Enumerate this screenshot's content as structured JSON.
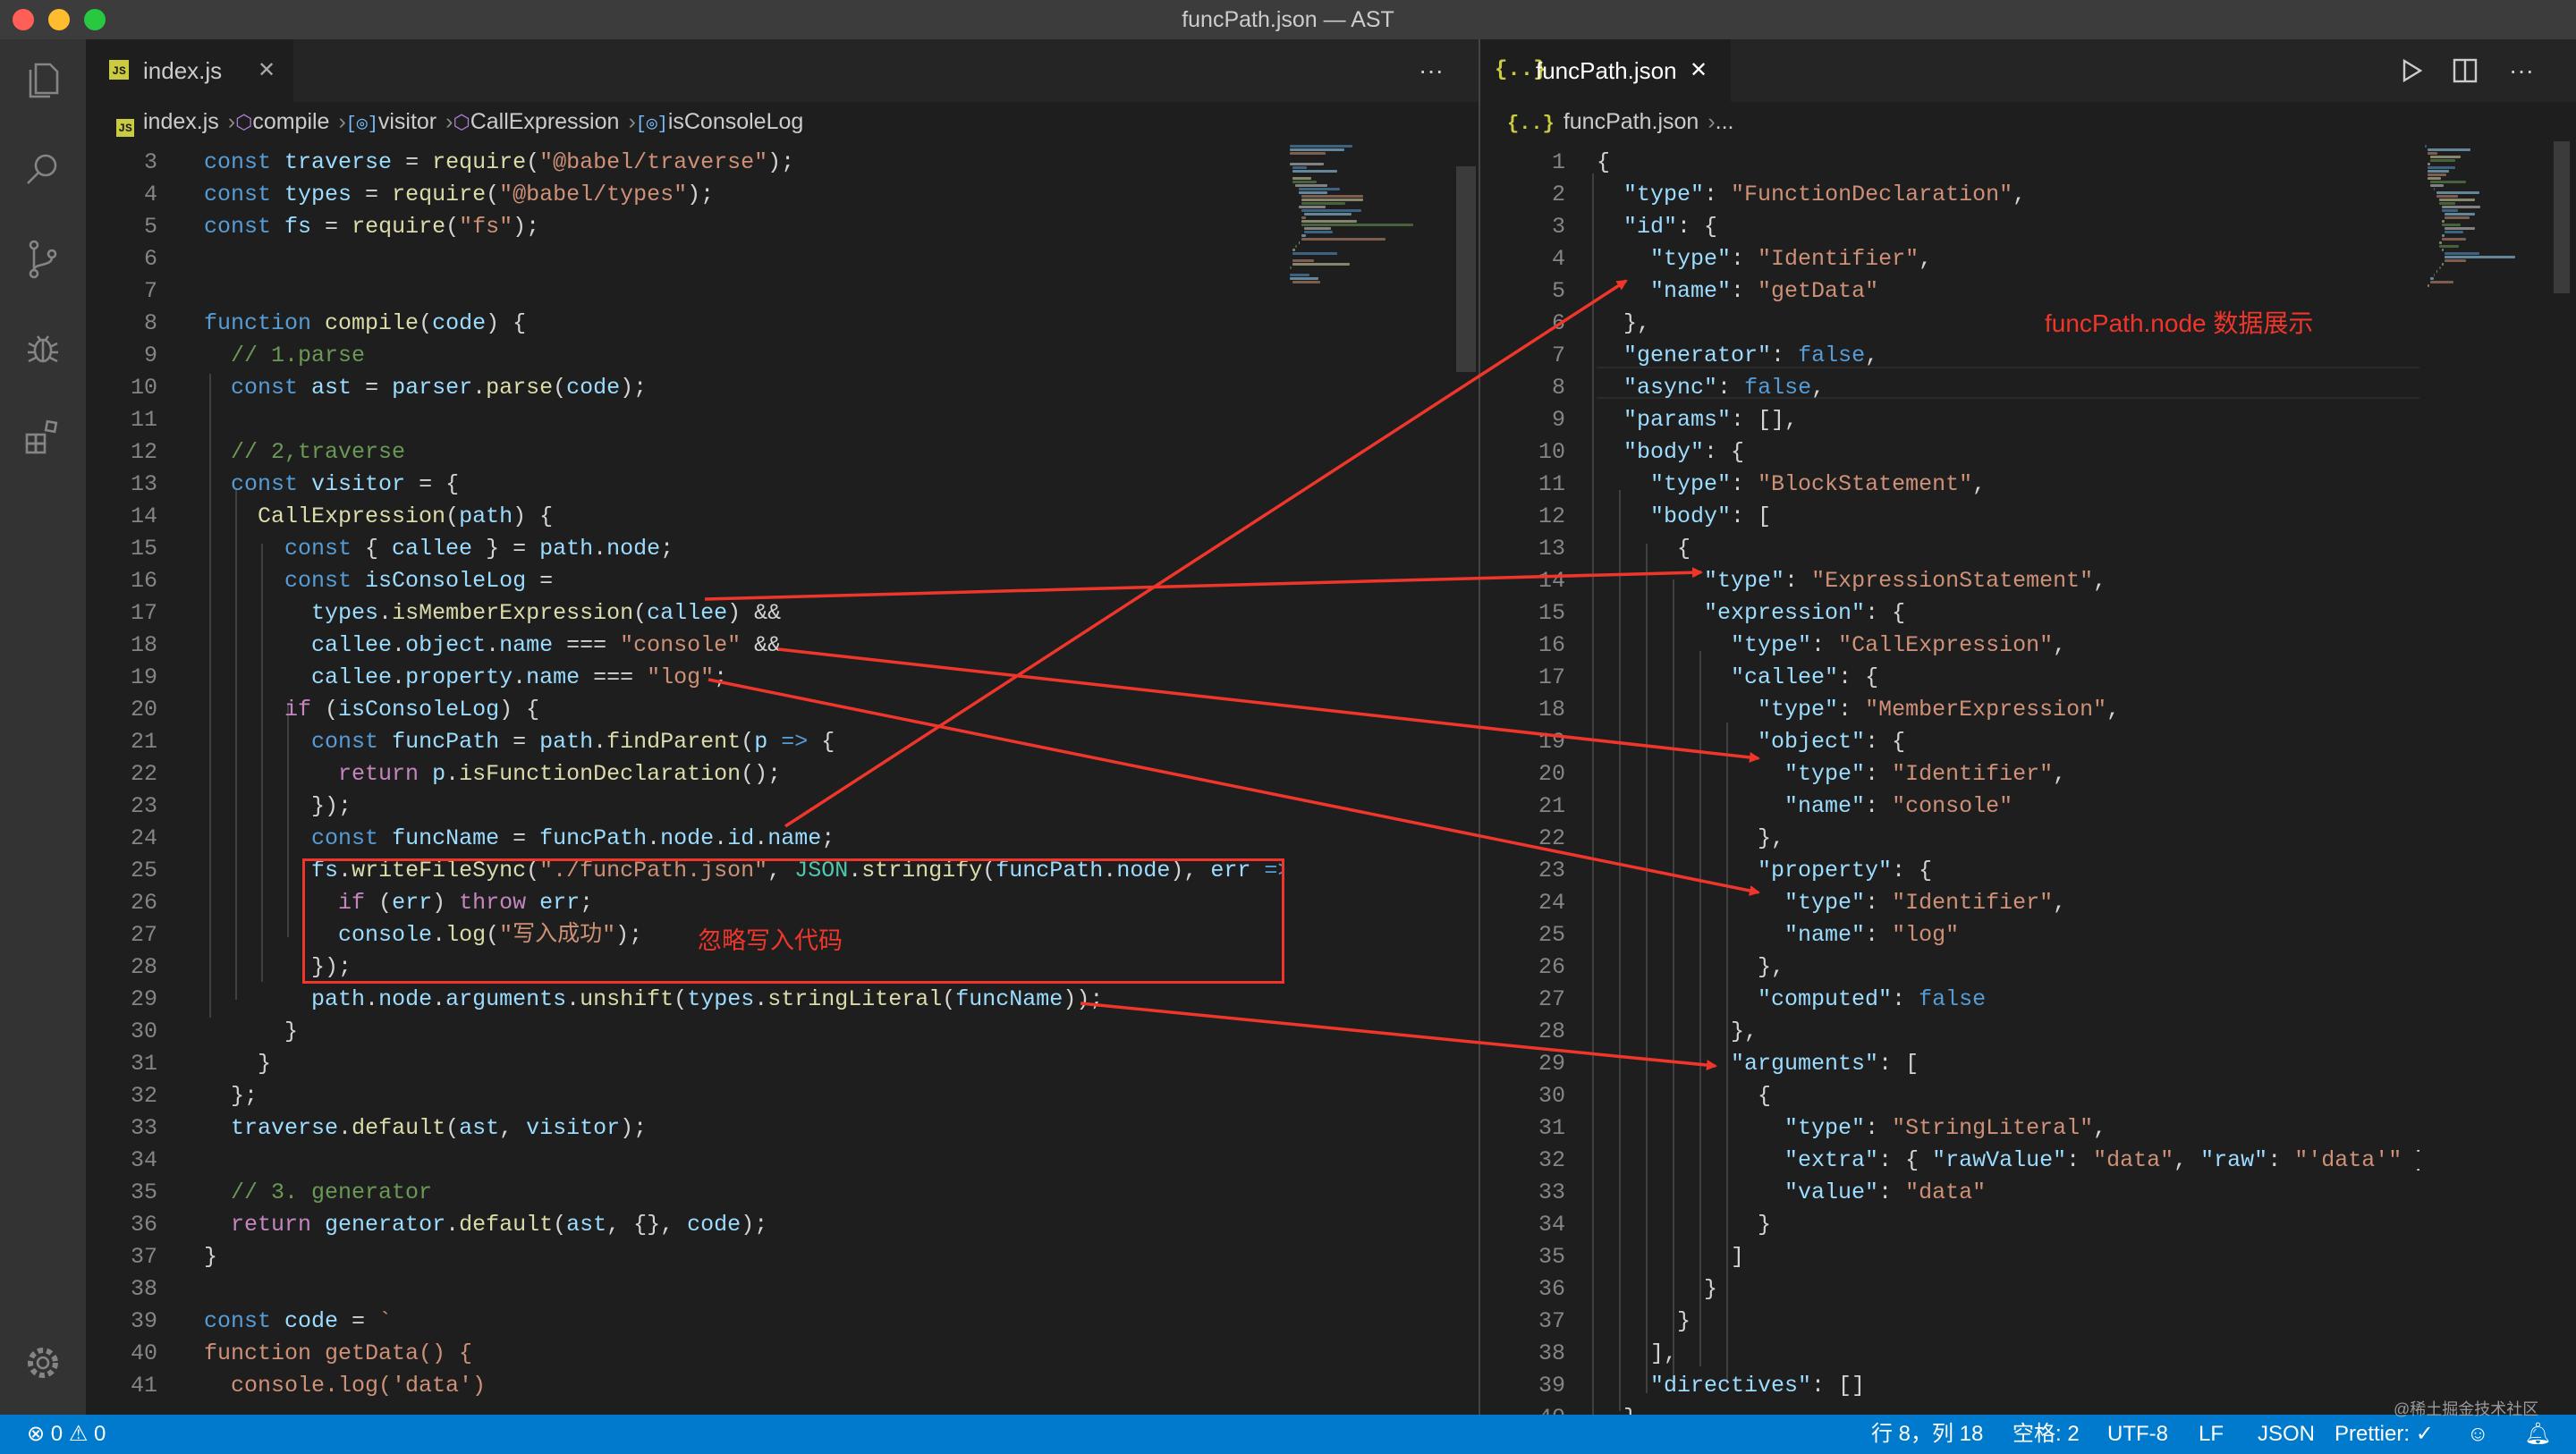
{
  "window": {
    "title": "funcPath.json — AST"
  },
  "colors": {
    "accent": "#007acc",
    "annotation": "#f0362b",
    "editor_bg": "#1e1e1e"
  },
  "activity_bar": {
    "items": [
      {
        "name": "explorer",
        "icon": "files-icon"
      },
      {
        "name": "search",
        "icon": "search-icon"
      },
      {
        "name": "source-control",
        "icon": "source-control-icon"
      },
      {
        "name": "run-debug",
        "icon": "debug-icon"
      },
      {
        "name": "extensions",
        "icon": "extensions-icon"
      }
    ],
    "settings_icon": "gear-icon"
  },
  "left_editor": {
    "tab": {
      "label": "index.js",
      "icon_text": "JS"
    },
    "more_label": "···",
    "breadcrumbs": [
      "index.js",
      "compile",
      "visitor",
      "CallExpression",
      "isConsoleLog"
    ],
    "lines": [
      {
        "n": "3",
        "html": "<span class=\"k\">const</span> <span class=\"v\">traverse</span> = <span class=\"f\">require</span>(<span class=\"s\">\"@babel/traverse\"</span>);"
      },
      {
        "n": "4",
        "html": "<span class=\"k\">const</span> <span class=\"v\">types</span> = <span class=\"f\">require</span>(<span class=\"s\">\"@babel/types\"</span>);"
      },
      {
        "n": "5",
        "html": "<span class=\"k\">const</span> <span class=\"v\">fs</span> = <span class=\"f\">require</span>(<span class=\"s\">\"fs\"</span>);"
      },
      {
        "n": "6",
        "html": ""
      },
      {
        "n": "7",
        "html": ""
      },
      {
        "n": "8",
        "html": "<span class=\"k\">function</span> <span class=\"f\">compile</span>(<span class=\"v\">code</span>) {"
      },
      {
        "n": "9",
        "html": "  <span class=\"cm\">// 1.parse</span>"
      },
      {
        "n": "10",
        "html": "  <span class=\"k\">const</span> <span class=\"v\">ast</span> = <span class=\"v\">parser</span>.<span class=\"f\">parse</span>(<span class=\"v\">code</span>);"
      },
      {
        "n": "11",
        "html": ""
      },
      {
        "n": "12",
        "html": "  <span class=\"cm\">// 2,traverse</span>"
      },
      {
        "n": "13",
        "html": "  <span class=\"k\">const</span> <span class=\"v\">visitor</span> = {"
      },
      {
        "n": "14",
        "html": "    <span class=\"f\">CallExpression</span>(<span class=\"v\">path</span>) {"
      },
      {
        "n": "15",
        "html": "      <span class=\"k\">const</span> { <span class=\"v\">callee</span> } = <span class=\"v\">path</span>.<span class=\"v\">node</span>;"
      },
      {
        "n": "16",
        "html": "      <span class=\"k\">const</span> <span class=\"v\">isConsoleLog</span> ="
      },
      {
        "n": "17",
        "html": "        <span class=\"v\">types</span>.<span class=\"f\">isMemberExpression</span>(<span class=\"v\">callee</span>) &amp;&amp;"
      },
      {
        "n": "18",
        "html": "        <span class=\"v\">callee</span>.<span class=\"v\">object</span>.<span class=\"v\">name</span> === <span class=\"s\">\"console\"</span> &amp;&amp;"
      },
      {
        "n": "19",
        "html": "        <span class=\"v\">callee</span>.<span class=\"v\">property</span>.<span class=\"v\">name</span> === <span class=\"s\">\"log\"</span>;"
      },
      {
        "n": "20",
        "html": "      <span class=\"c\">if</span> (<span class=\"v\">isConsoleLog</span>) {"
      },
      {
        "n": "21",
        "html": "        <span class=\"k\">const</span> <span class=\"v\">funcPath</span> = <span class=\"v\">path</span>.<span class=\"f\">findParent</span>(<span class=\"v\">p</span> <span class=\"k\">=&gt;</span> {"
      },
      {
        "n": "22",
        "html": "          <span class=\"c\">return</span> <span class=\"v\">p</span>.<span class=\"f\">isFunctionDeclaration</span>();"
      },
      {
        "n": "23",
        "html": "        });"
      },
      {
        "n": "24",
        "html": "        <span class=\"k\">const</span> <span class=\"v\">funcName</span> = <span class=\"v\">funcPath</span>.<span class=\"v\">node</span>.<span class=\"v\">id</span>.<span class=\"v\">name</span>;"
      },
      {
        "n": "25",
        "html": "        <span class=\"v\">fs</span>.<span class=\"f\">writeFileSync</span>(<span class=\"s\">\"./funcPath.json\"</span>, <span class=\"t\">JSON</span>.<span class=\"f\">stringify</span>(<span class=\"v\">funcPath</span>.<span class=\"v\">node</span>), <span class=\"v\">err</span> <span class=\"k\">=&gt;</span> {"
      },
      {
        "n": "26",
        "html": "          <span class=\"c\">if</span> (<span class=\"v\">err</span>) <span class=\"c\">throw</span> <span class=\"v\">err</span>;"
      },
      {
        "n": "27",
        "html": "          <span class=\"v\">console</span>.<span class=\"f\">log</span>(<span class=\"s\">\"写入成功\"</span>);"
      },
      {
        "n": "28",
        "html": "        });"
      },
      {
        "n": "29",
        "html": "        <span class=\"v\">path</span>.<span class=\"v\">node</span>.<span class=\"v\">arguments</span>.<span class=\"f\">unshift</span>(<span class=\"v\">types</span>.<span class=\"f\">stringLiteral</span>(<span class=\"v\">funcName</span>));"
      },
      {
        "n": "30",
        "html": "      }"
      },
      {
        "n": "31",
        "html": "    }"
      },
      {
        "n": "32",
        "html": "  };"
      },
      {
        "n": "33",
        "html": "  <span class=\"v\">traverse</span>.<span class=\"f\">default</span>(<span class=\"v\">ast</span>, <span class=\"v\">visitor</span>);"
      },
      {
        "n": "34",
        "html": ""
      },
      {
        "n": "35",
        "html": "  <span class=\"cm\">// 3. generator</span>"
      },
      {
        "n": "36",
        "html": "  <span class=\"c\">return</span> <span class=\"v\">generator</span>.<span class=\"f\">default</span>(<span class=\"v\">ast</span>, {}, <span class=\"v\">code</span>);"
      },
      {
        "n": "37",
        "html": "}"
      },
      {
        "n": "38",
        "html": ""
      },
      {
        "n": "39",
        "html": "<span class=\"k\">const</span> <span class=\"v\">code</span> = <span class=\"s\">`</span>"
      },
      {
        "n": "40",
        "html": "<span class=\"s\">function getData() {</span>"
      },
      {
        "n": "41",
        "html": "<span class=\"s\">  console.log('data')</span>"
      }
    ]
  },
  "right_editor": {
    "tab": {
      "label": "funcPath.json",
      "icon_text": "{..}"
    },
    "breadcrumbs": [
      "funcPath.json",
      "..."
    ],
    "lines": [
      {
        "n": "1",
        "html": "{"
      },
      {
        "n": "2",
        "html": "  <span class=\"jk\">\"type\"</span>: <span class=\"js\">\"FunctionDeclaration\"</span>,"
      },
      {
        "n": "3",
        "html": "  <span class=\"jk\">\"id\"</span>: {"
      },
      {
        "n": "4",
        "html": "    <span class=\"jk\">\"type\"</span>: <span class=\"js\">\"Identifier\"</span>,"
      },
      {
        "n": "5",
        "html": "    <span class=\"jk\">\"name\"</span>: <span class=\"js\">\"getData\"</span>"
      },
      {
        "n": "6",
        "html": "  },"
      },
      {
        "n": "7",
        "html": "  <span class=\"jk\">\"generator\"</span>: <span class=\"jb\">false</span>,"
      },
      {
        "n": "8",
        "html": "  <span class=\"jk\">\"async\"</span>: <span class=\"jb\">false</span>,"
      },
      {
        "n": "9",
        "html": "  <span class=\"jk\">\"params\"</span>: [],"
      },
      {
        "n": "10",
        "html": "  <span class=\"jk\">\"body\"</span>: {"
      },
      {
        "n": "11",
        "html": "    <span class=\"jk\">\"type\"</span>: <span class=\"js\">\"BlockStatement\"</span>,"
      },
      {
        "n": "12",
        "html": "    <span class=\"jk\">\"body\"</span>: ["
      },
      {
        "n": "13",
        "html": "      {"
      },
      {
        "n": "14",
        "html": "        <span class=\"jk\">\"type\"</span>: <span class=\"js\">\"ExpressionStatement\"</span>,"
      },
      {
        "n": "15",
        "html": "        <span class=\"jk\">\"expression\"</span>: {"
      },
      {
        "n": "16",
        "html": "          <span class=\"jk\">\"type\"</span>: <span class=\"js\">\"CallExpression\"</span>,"
      },
      {
        "n": "17",
        "html": "          <span class=\"jk\">\"callee\"</span>: {"
      },
      {
        "n": "18",
        "html": "            <span class=\"jk\">\"type\"</span>: <span class=\"js\">\"MemberExpression\"</span>,"
      },
      {
        "n": "19",
        "html": "            <span class=\"jk\">\"object\"</span>: {"
      },
      {
        "n": "20",
        "html": "              <span class=\"jk\">\"type\"</span>: <span class=\"js\">\"Identifier\"</span>,"
      },
      {
        "n": "21",
        "html": "              <span class=\"jk\">\"name\"</span>: <span class=\"js\">\"console\"</span>"
      },
      {
        "n": "22",
        "html": "            },"
      },
      {
        "n": "23",
        "html": "            <span class=\"jk\">\"property\"</span>: {"
      },
      {
        "n": "24",
        "html": "              <span class=\"jk\">\"type\"</span>: <span class=\"js\">\"Identifier\"</span>,"
      },
      {
        "n": "25",
        "html": "              <span class=\"jk\">\"name\"</span>: <span class=\"js\">\"log\"</span>"
      },
      {
        "n": "26",
        "html": "            },"
      },
      {
        "n": "27",
        "html": "            <span class=\"jk\">\"computed\"</span>: <span class=\"jb\">false</span>"
      },
      {
        "n": "28",
        "html": "          },"
      },
      {
        "n": "29",
        "html": "          <span class=\"jk\">\"arguments\"</span>: ["
      },
      {
        "n": "30",
        "html": "            {"
      },
      {
        "n": "31",
        "html": "              <span class=\"jk\">\"type\"</span>: <span class=\"js\">\"StringLiteral\"</span>,"
      },
      {
        "n": "32",
        "html": "              <span class=\"jk\">\"extra\"</span>: { <span class=\"jk\">\"rawValue\"</span>: <span class=\"js\">\"data\"</span>, <span class=\"jk\">\"raw\"</span>: <span class=\"js\">\"'data'\"</span> },"
      },
      {
        "n": "33",
        "html": "              <span class=\"jk\">\"value\"</span>: <span class=\"js\">\"data\"</span>"
      },
      {
        "n": "34",
        "html": "            }"
      },
      {
        "n": "35",
        "html": "          ]"
      },
      {
        "n": "36",
        "html": "        }"
      },
      {
        "n": "37",
        "html": "      }"
      },
      {
        "n": "38",
        "html": "    ],"
      },
      {
        "n": "39",
        "html": "    <span class=\"jk\">\"directives\"</span>: []"
      },
      {
        "n": "40",
        "html": "  }"
      }
    ]
  },
  "annotations": {
    "right_note": "funcPath.node 数据展示",
    "left_note": "忽略写入代码"
  },
  "statusbar": {
    "errors": "0",
    "warnings": "0",
    "position": "行 8，列 18",
    "indent": "空格: 2",
    "encoding": "UTF-8",
    "eol": "LF",
    "language": "JSON",
    "prettier": "Prettier: ✓",
    "watermark": "@稀土掘金技术社区"
  }
}
